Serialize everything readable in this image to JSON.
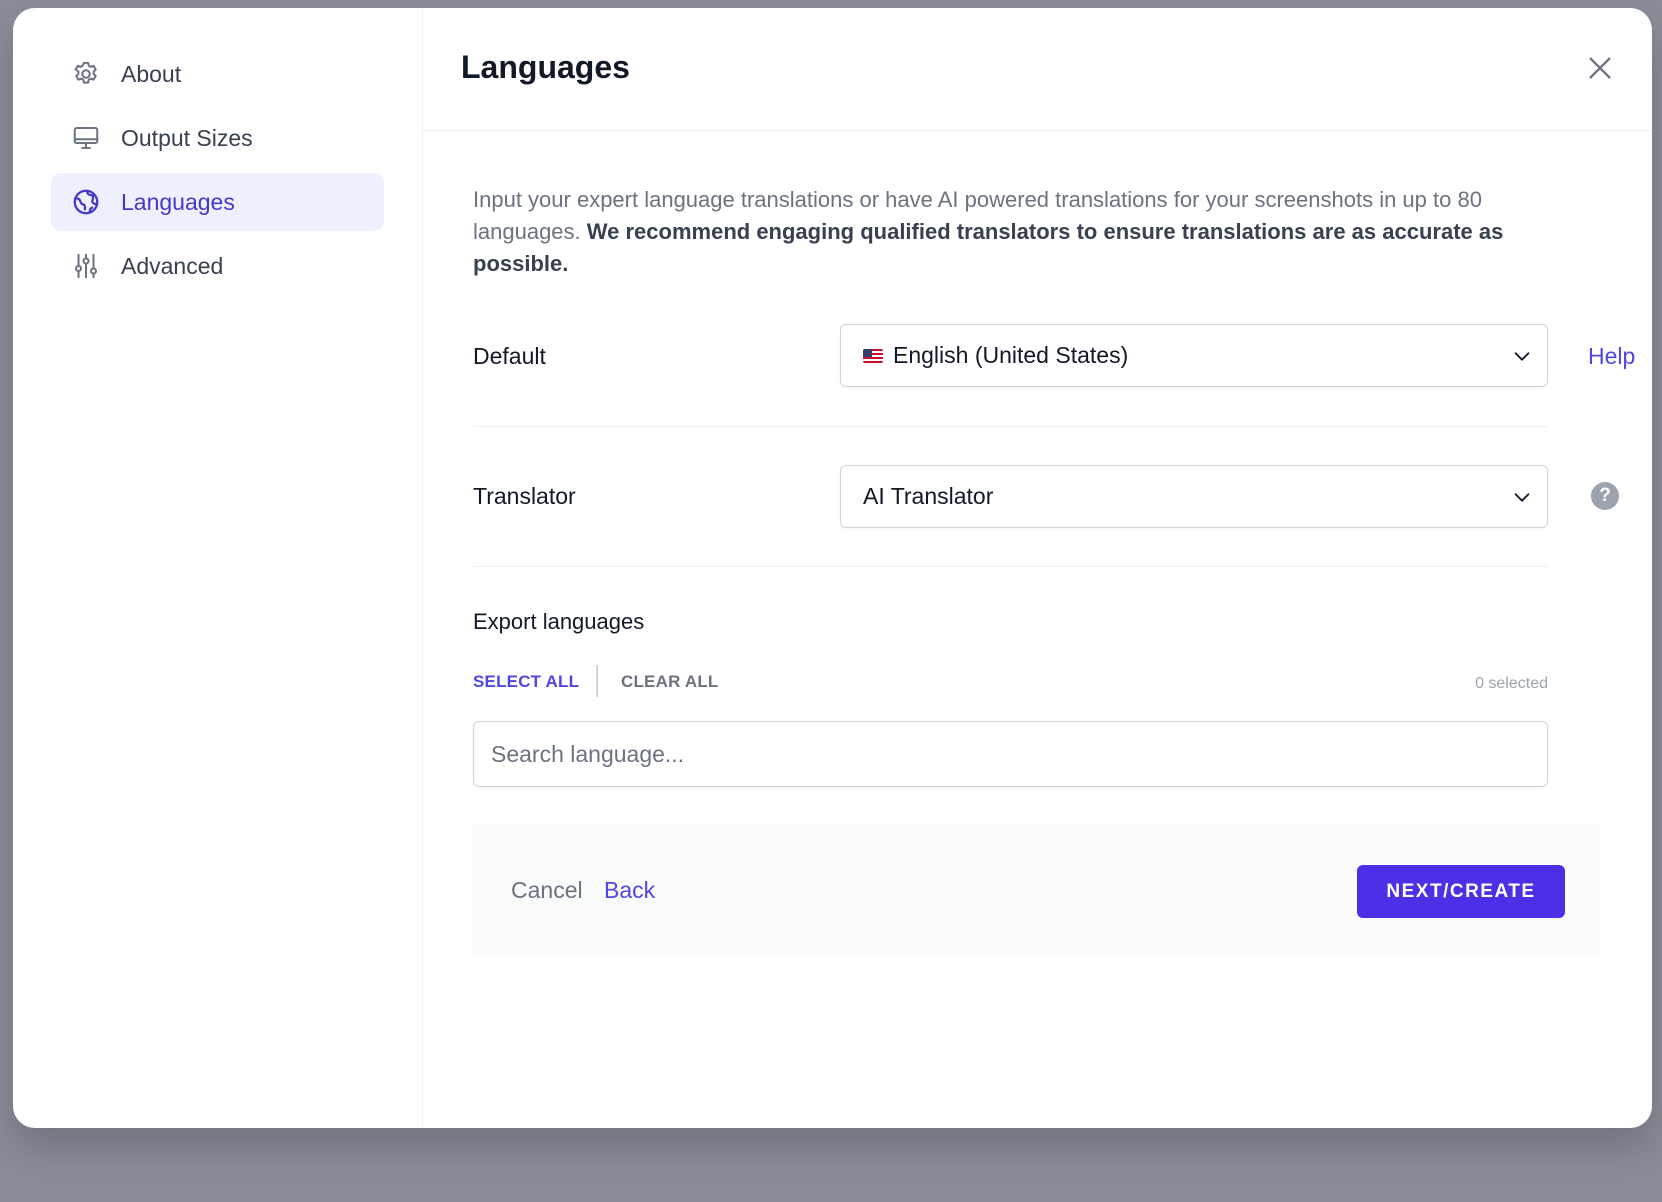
{
  "sidebar": {
    "items": [
      {
        "label": "About",
        "icon": "gear-icon"
      },
      {
        "label": "Output Sizes",
        "icon": "monitor-icon"
      },
      {
        "label": "Languages",
        "icon": "globe-icon",
        "active": true
      },
      {
        "label": "Advanced",
        "icon": "sliders-icon"
      }
    ]
  },
  "header": {
    "title": "Languages",
    "close_icon": "close-icon"
  },
  "intro": {
    "text": "Input your expert language translations or have AI powered translations for your screenshots in up to 80 languages.",
    "bold_text": "We recommend engaging qualified translators to ensure translations are as accurate as possible."
  },
  "default_row": {
    "label": "Default",
    "value": "English (United States)",
    "flag": "us-flag-icon",
    "help_link": "Help"
  },
  "translator_row": {
    "label": "Translator",
    "value": "AI Translator",
    "help_icon": "question-circle-icon"
  },
  "export": {
    "title": "Export languages",
    "select_all": "SELECT ALL",
    "clear_all": "CLEAR ALL",
    "selected_count": "0 selected",
    "search_placeholder": "Search language..."
  },
  "footer": {
    "cancel_label": "Cancel",
    "back_label": "Back",
    "next_label": "NEXT/CREATE"
  },
  "colors": {
    "accent": "#4f46e5",
    "primary_button": "#4f2ee8",
    "active_nav_bg": "#eef0fe",
    "backdrop": "#898d98"
  }
}
